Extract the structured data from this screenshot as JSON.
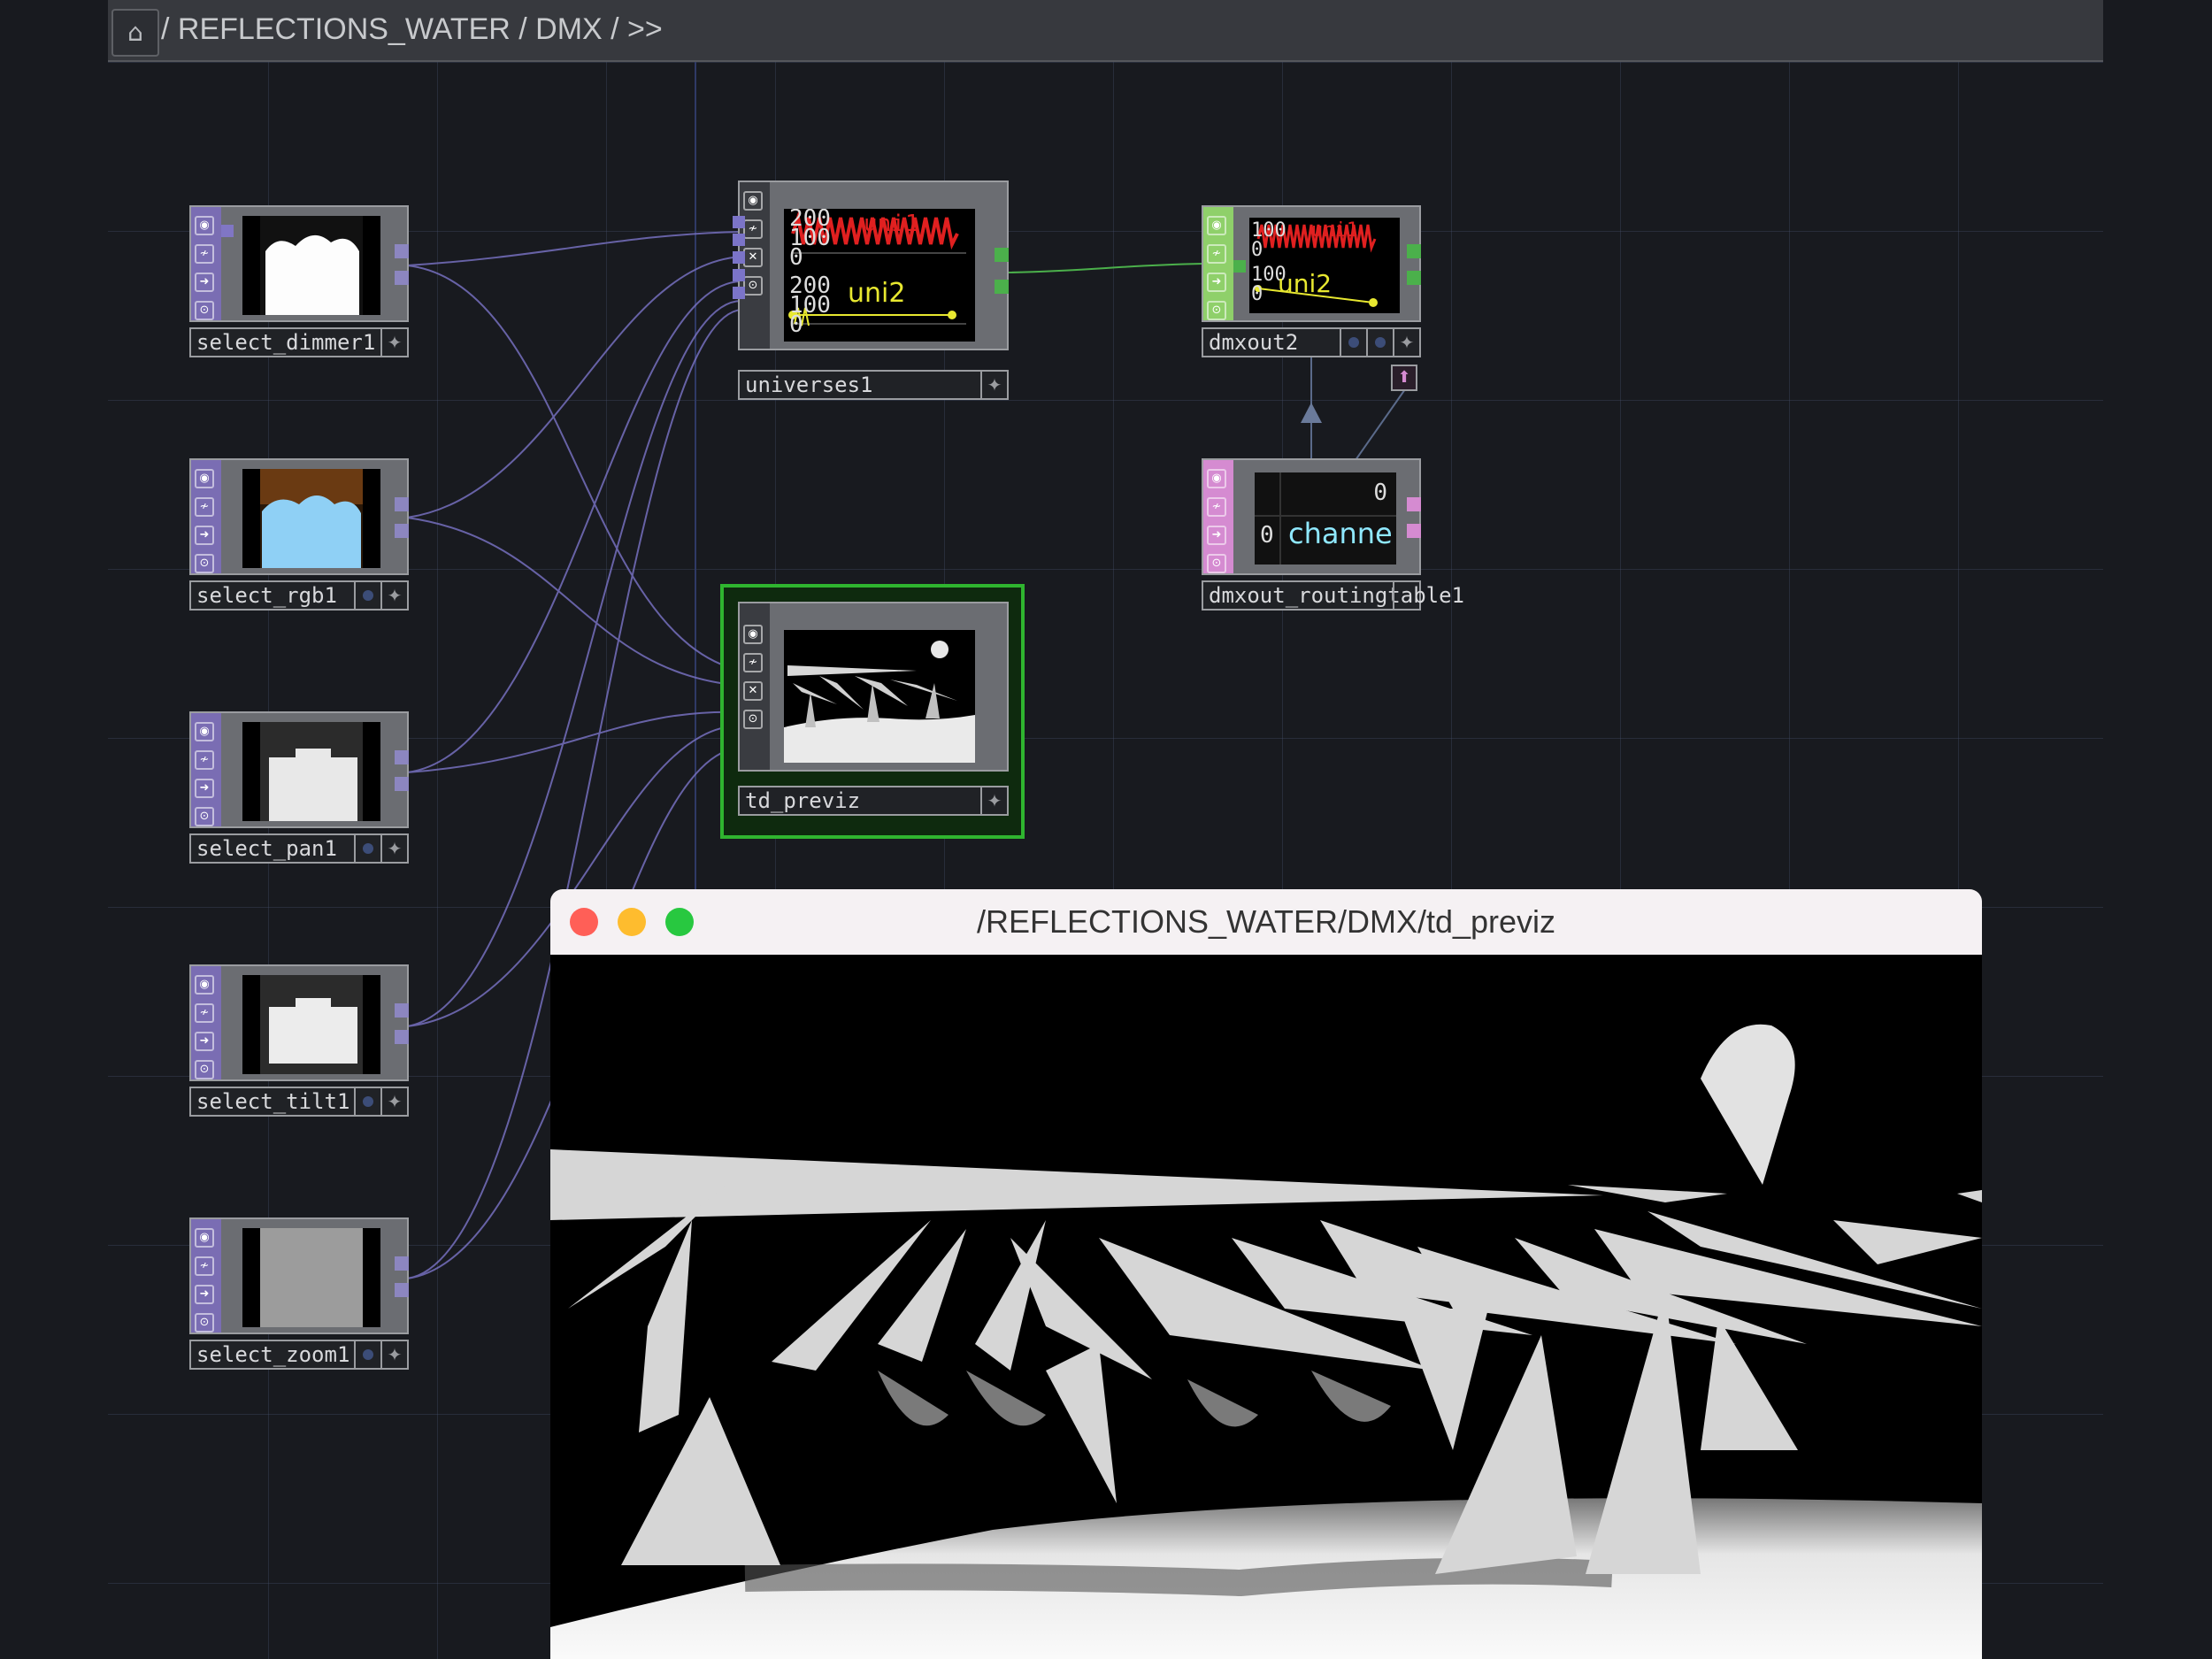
{
  "pathbar": {
    "home_icon": "home-icon",
    "path": "/ REFLECTIONS_WATER / DMX / >>"
  },
  "nodes": {
    "select_dimmer1": {
      "label": "select_dimmer1",
      "color": "#7a6db3"
    },
    "select_rgb1": {
      "label": "select_rgb1",
      "color": "#7a6db3"
    },
    "select_pan1": {
      "label": "select_pan1",
      "color": "#7a6db3"
    },
    "select_tilt1": {
      "label": "select_tilt1",
      "color": "#7a6db3"
    },
    "select_zoom1": {
      "label": "select_zoom1",
      "color": "#7a6db3"
    },
    "universes1": {
      "label": "universes1",
      "color": "#6b6d72",
      "viewer_lines": [
        "200",
        "100",
        "0",
        "200",
        "100",
        "0"
      ],
      "viewer_series": [
        "uni1",
        "uni2"
      ]
    },
    "td_previz": {
      "label": "td_previz",
      "color": "#6b6d72",
      "highlight": "#2fb52f"
    },
    "dmxout2": {
      "label": "dmxout2",
      "color": "#8fd06a",
      "viewer_lines": [
        "100",
        "0",
        "100",
        "0"
      ],
      "viewer_series": [
        "uni1",
        "uni2"
      ]
    },
    "dmxout_routingtable1": {
      "label": "dmxout_routingtable1",
      "color": "#d58bd1",
      "cell_top": "0",
      "cell_left": "0",
      "cell_text": "channe"
    }
  },
  "window": {
    "title": "/REFLECTIONS_WATER/DMX/td_previz",
    "close_color": "#ff5f57",
    "minimize_color": "#febc2e",
    "zoom_color": "#28c840"
  }
}
